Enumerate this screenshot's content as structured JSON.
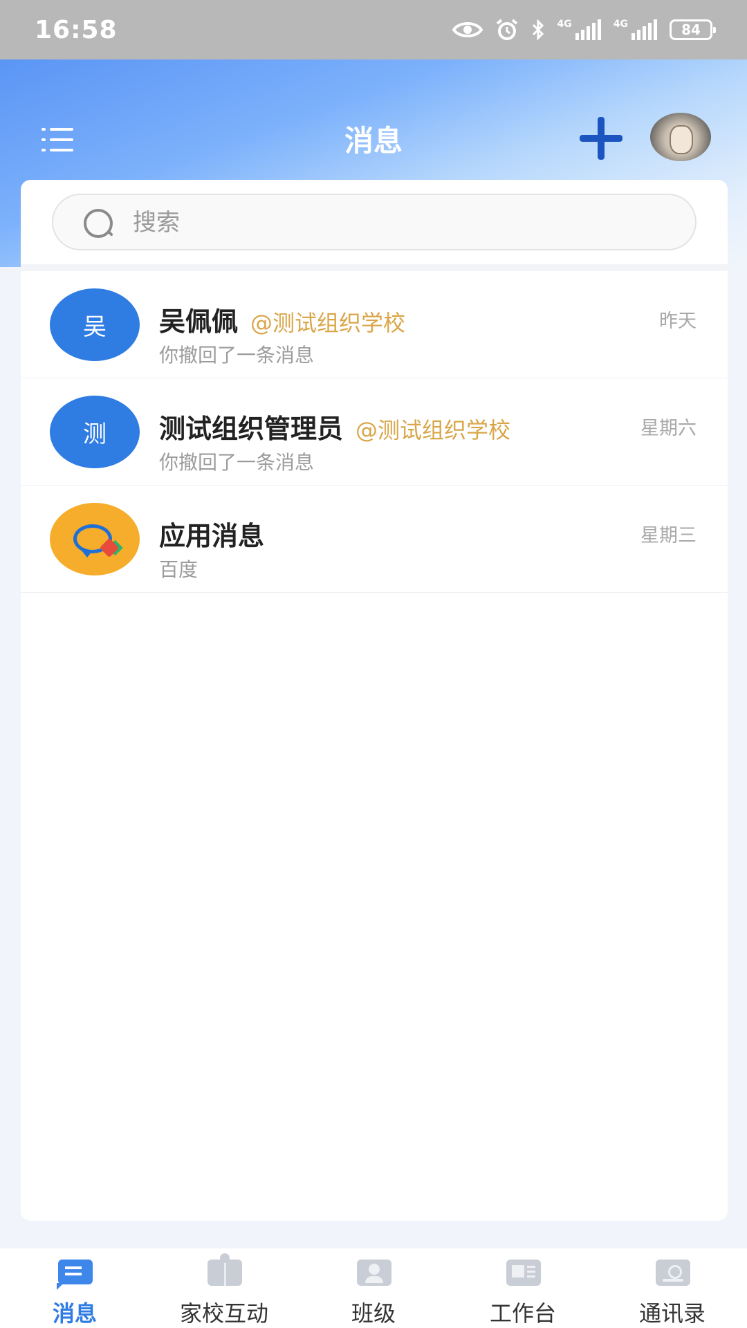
{
  "status_bar": {
    "time": "16:58",
    "network_1": "4G",
    "network_2": "4G",
    "battery": "84",
    "icons": [
      "eye-icon",
      "alarm-icon",
      "bluetooth-icon",
      "signal-icon",
      "signal-icon",
      "battery-icon"
    ]
  },
  "header": {
    "title": "消息",
    "menu_icon": "menu-icon",
    "add_icon": "plus-icon",
    "accent_color": "#1c55c0"
  },
  "search": {
    "placeholder": "搜索"
  },
  "conversations": [
    {
      "avatar_text": "吴",
      "avatar_color": "#2f7ce3",
      "name": "吴佩佩",
      "org": "@测试组织学校",
      "preview": "你撤回了一条消息",
      "time": "昨天"
    },
    {
      "avatar_text": "测",
      "avatar_color": "#2f7ce3",
      "name": "测试组织管理员",
      "org": "@测试组织学校",
      "preview": "你撤回了一条消息",
      "time": "星期六"
    },
    {
      "avatar_icon": "app-message-icon",
      "avatar_color": "#f5ad2b",
      "name": "应用消息",
      "org": "",
      "preview": "百度",
      "time": "星期三"
    }
  ],
  "tabbar": {
    "active_color": "#2f7ce3",
    "tabs": [
      {
        "label": "消息",
        "icon": "message-icon",
        "active": true
      },
      {
        "label": "家校互动",
        "icon": "book-icon",
        "active": false
      },
      {
        "label": "班级",
        "icon": "class-icon",
        "active": false
      },
      {
        "label": "工作台",
        "icon": "workbench-icon",
        "active": false
      },
      {
        "label": "通讯录",
        "icon": "contacts-icon",
        "active": false
      }
    ]
  }
}
